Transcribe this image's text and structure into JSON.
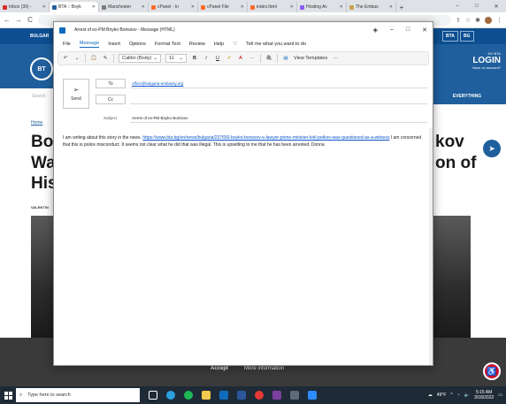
{
  "browser": {
    "tabs": [
      {
        "label": "Inbox (30) -",
        "color": "#d93025"
      },
      {
        "label": "BTA :: Boyk",
        "color": "#1f5f9d",
        "active": true
      },
      {
        "label": "Manchester",
        "color": "#7a7a7a"
      },
      {
        "label": "cPanel - In",
        "color": "#ff6c2c"
      },
      {
        "label": "cPanel File",
        "color": "#ff6c2c"
      },
      {
        "label": "index.html",
        "color": "#ff6c2c"
      },
      {
        "label": "Hosting Ac",
        "color": "#8b5cf6"
      },
      {
        "label": "The Embas",
        "color": "#c8a04c"
      }
    ],
    "new_tab_icon": "+",
    "nav_back_icon": "←",
    "nav_forward_icon": "→",
    "reload_icon": "C"
  },
  "site": {
    "top_left": "BULGAR",
    "lang_bta": "BTA",
    "lang_bg": "BG",
    "logo_text": "BT",
    "login_small": "MY BTA",
    "login_big": "LOGIN",
    "login_sub": "Have no account?",
    "search_placeholder": "Search",
    "events_label": "EVERYTHING",
    "breadcrumb": "Home",
    "headline_left": [
      "Bo",
      "Wa",
      "His"
    ],
    "headline_right": [
      "kov",
      "on of"
    ],
    "author": "VALENTIN",
    "cookie_accept": "Accept",
    "cookie_more": "More information"
  },
  "outlook": {
    "title": "Arrest of ex-PM Boyko Borissov - Message (HTML)",
    "menu": [
      "File",
      "Message",
      "Insert",
      "Options",
      "Format Text",
      "Review",
      "Help"
    ],
    "tell_me": "Tell me what you want to do",
    "ribbon": {
      "font": "Calibri (Body)",
      "size": "11",
      "bold": "B",
      "italic": "I",
      "underline": "U",
      "templates": "View Templates",
      "more": "···"
    },
    "send_label": "Send",
    "to_label": "To",
    "cc_label": "Cc",
    "subject_label": "Subject",
    "to_value": "office@bulgaria-embassy.org",
    "cc_value": "",
    "subject_value": "Arrest of ex-PM Boyko Borissov",
    "body_intro": "I am writing about this story in the news. ",
    "body_link": "https://www.bta.bg/en/news/bulgaria/237650-boyko-borissov-s-lawyer-prime-minister-kiril-petkov-was-questioned-as-a-witness",
    "body_rest": " I am concerned that this is police misconduct. It seems not clear what he did that was illegal. This is upsetting to me that he has been arrested. Donna"
  },
  "taskbar": {
    "search_placeholder": "Type here to search",
    "weather": "49°F",
    "time": "5:15 AM",
    "date": "3/18/2022"
  },
  "colors": {
    "accent": "#0f6cbd",
    "site_blue": "#1f5f9d"
  }
}
